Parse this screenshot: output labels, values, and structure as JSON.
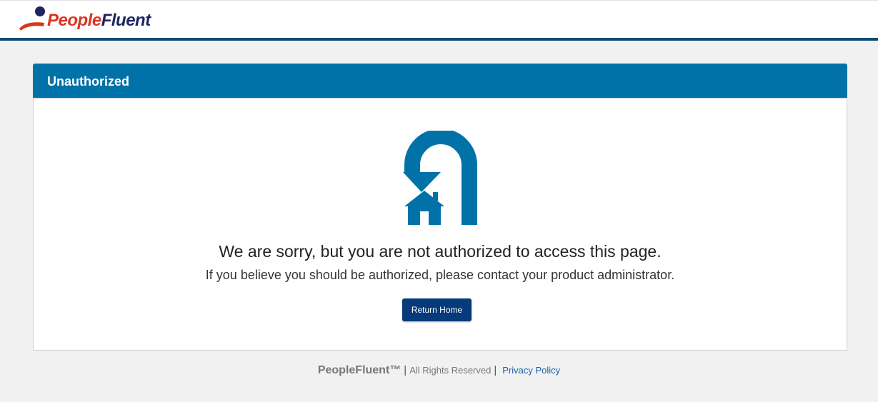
{
  "header": {
    "logo_word_people": "People",
    "logo_word_fluent": "Fluent"
  },
  "panel": {
    "title": "Unauthorized",
    "icon": "return-home-icon",
    "message_main": "We are sorry, but you are not authorized to access this page.",
    "message_sub": "If you believe you should be authorized, please contact your product administrator.",
    "return_button_label": "Return Home"
  },
  "footer": {
    "brand": "PeopleFluent™",
    "separator": "|",
    "rights": "All Rights Reserved",
    "privacy_link": "Privacy Policy"
  },
  "colors": {
    "header_blue": "#0072a8",
    "top_rule": "#0f4c6e",
    "button": "#063a7a",
    "logo_red": "#d9361f",
    "logo_navy": "#1e2560"
  }
}
